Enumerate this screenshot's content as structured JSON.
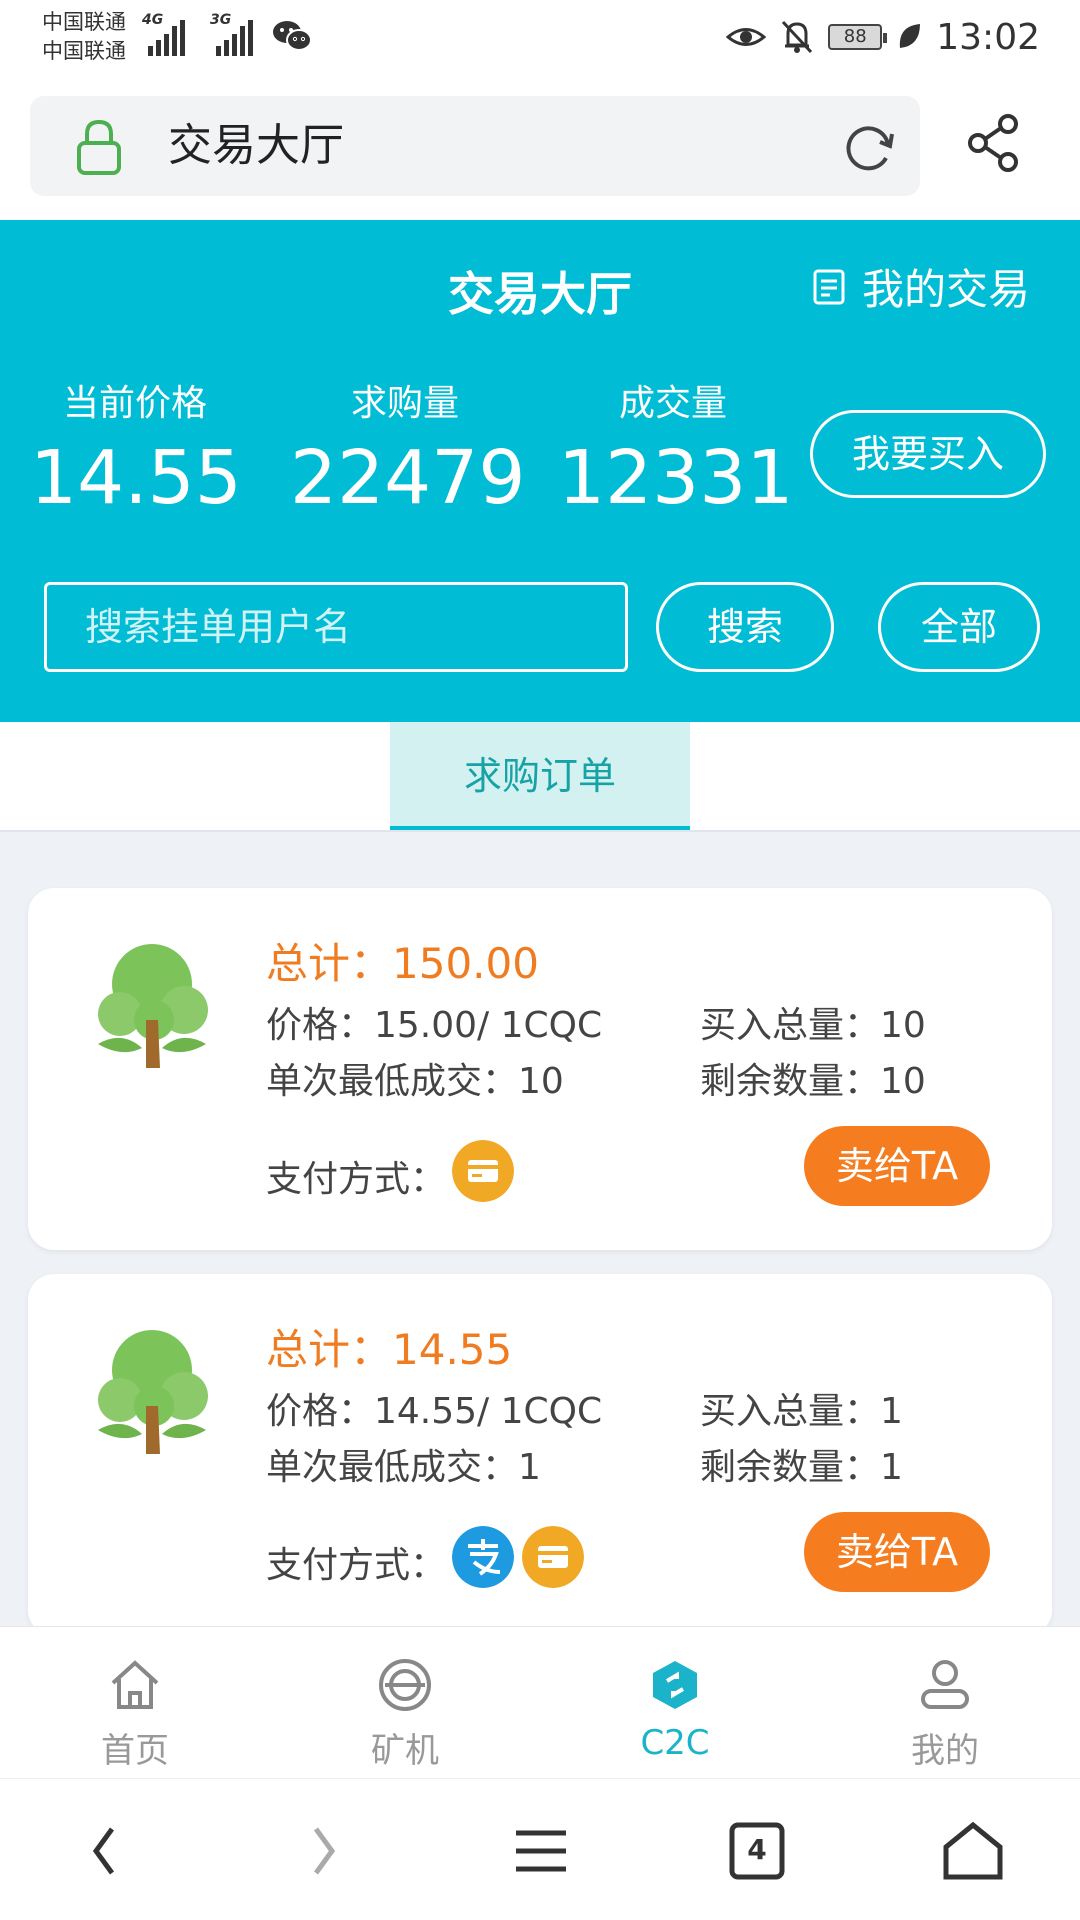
{
  "status_bar": {
    "carrier1": "中国联通",
    "carrier2": "中国联通",
    "net1": "4G",
    "net2": "3G",
    "battery": "88",
    "time": "13:02"
  },
  "browser": {
    "url_title": "交易大厅"
  },
  "header": {
    "title": "交易大厅",
    "my_trade": "我的交易",
    "stats": [
      {
        "label": "当前价格",
        "value": "14.55"
      },
      {
        "label": "求购量",
        "value": "22479"
      },
      {
        "label": "成交量",
        "value": "12331"
      }
    ],
    "buy_button": "我要买入",
    "search_placeholder": "搜索挂单用户名",
    "search_button": "搜索",
    "all_button": "全部"
  },
  "tabs": {
    "active": "求购订单"
  },
  "orders": [
    {
      "total": "总计：150.00",
      "price": "价格：15.00/ 1CQC",
      "buy_total": "买入总量：10",
      "min_trade": "单次最低成交：10",
      "remaining": "剩余数量：10",
      "pay_label": "支付方式：",
      "pay_icons": [
        "bank-card-icon"
      ],
      "sell_button": "卖给TA"
    },
    {
      "total": "总计：14.55",
      "price": "价格：14.55/ 1CQC",
      "buy_total": "买入总量：1",
      "min_trade": "单次最低成交：1",
      "remaining": "剩余数量：1",
      "pay_label": "支付方式：",
      "pay_icons": [
        "alipay-icon",
        "bank-card-icon"
      ],
      "sell_button": "卖给TA"
    }
  ],
  "bottom_nav": [
    {
      "label": "首页",
      "icon": "home-icon"
    },
    {
      "label": "矿机",
      "icon": "miner-icon"
    },
    {
      "label": "C2C",
      "icon": "c2c-icon",
      "active": true
    },
    {
      "label": "我的",
      "icon": "user-icon"
    }
  ],
  "system_nav": {
    "tab_count": "4"
  },
  "colors": {
    "primary": "#00bcd4",
    "accent": "#f57c1f",
    "total_text": "#f07c22",
    "active_nav": "#1ab3c9"
  }
}
